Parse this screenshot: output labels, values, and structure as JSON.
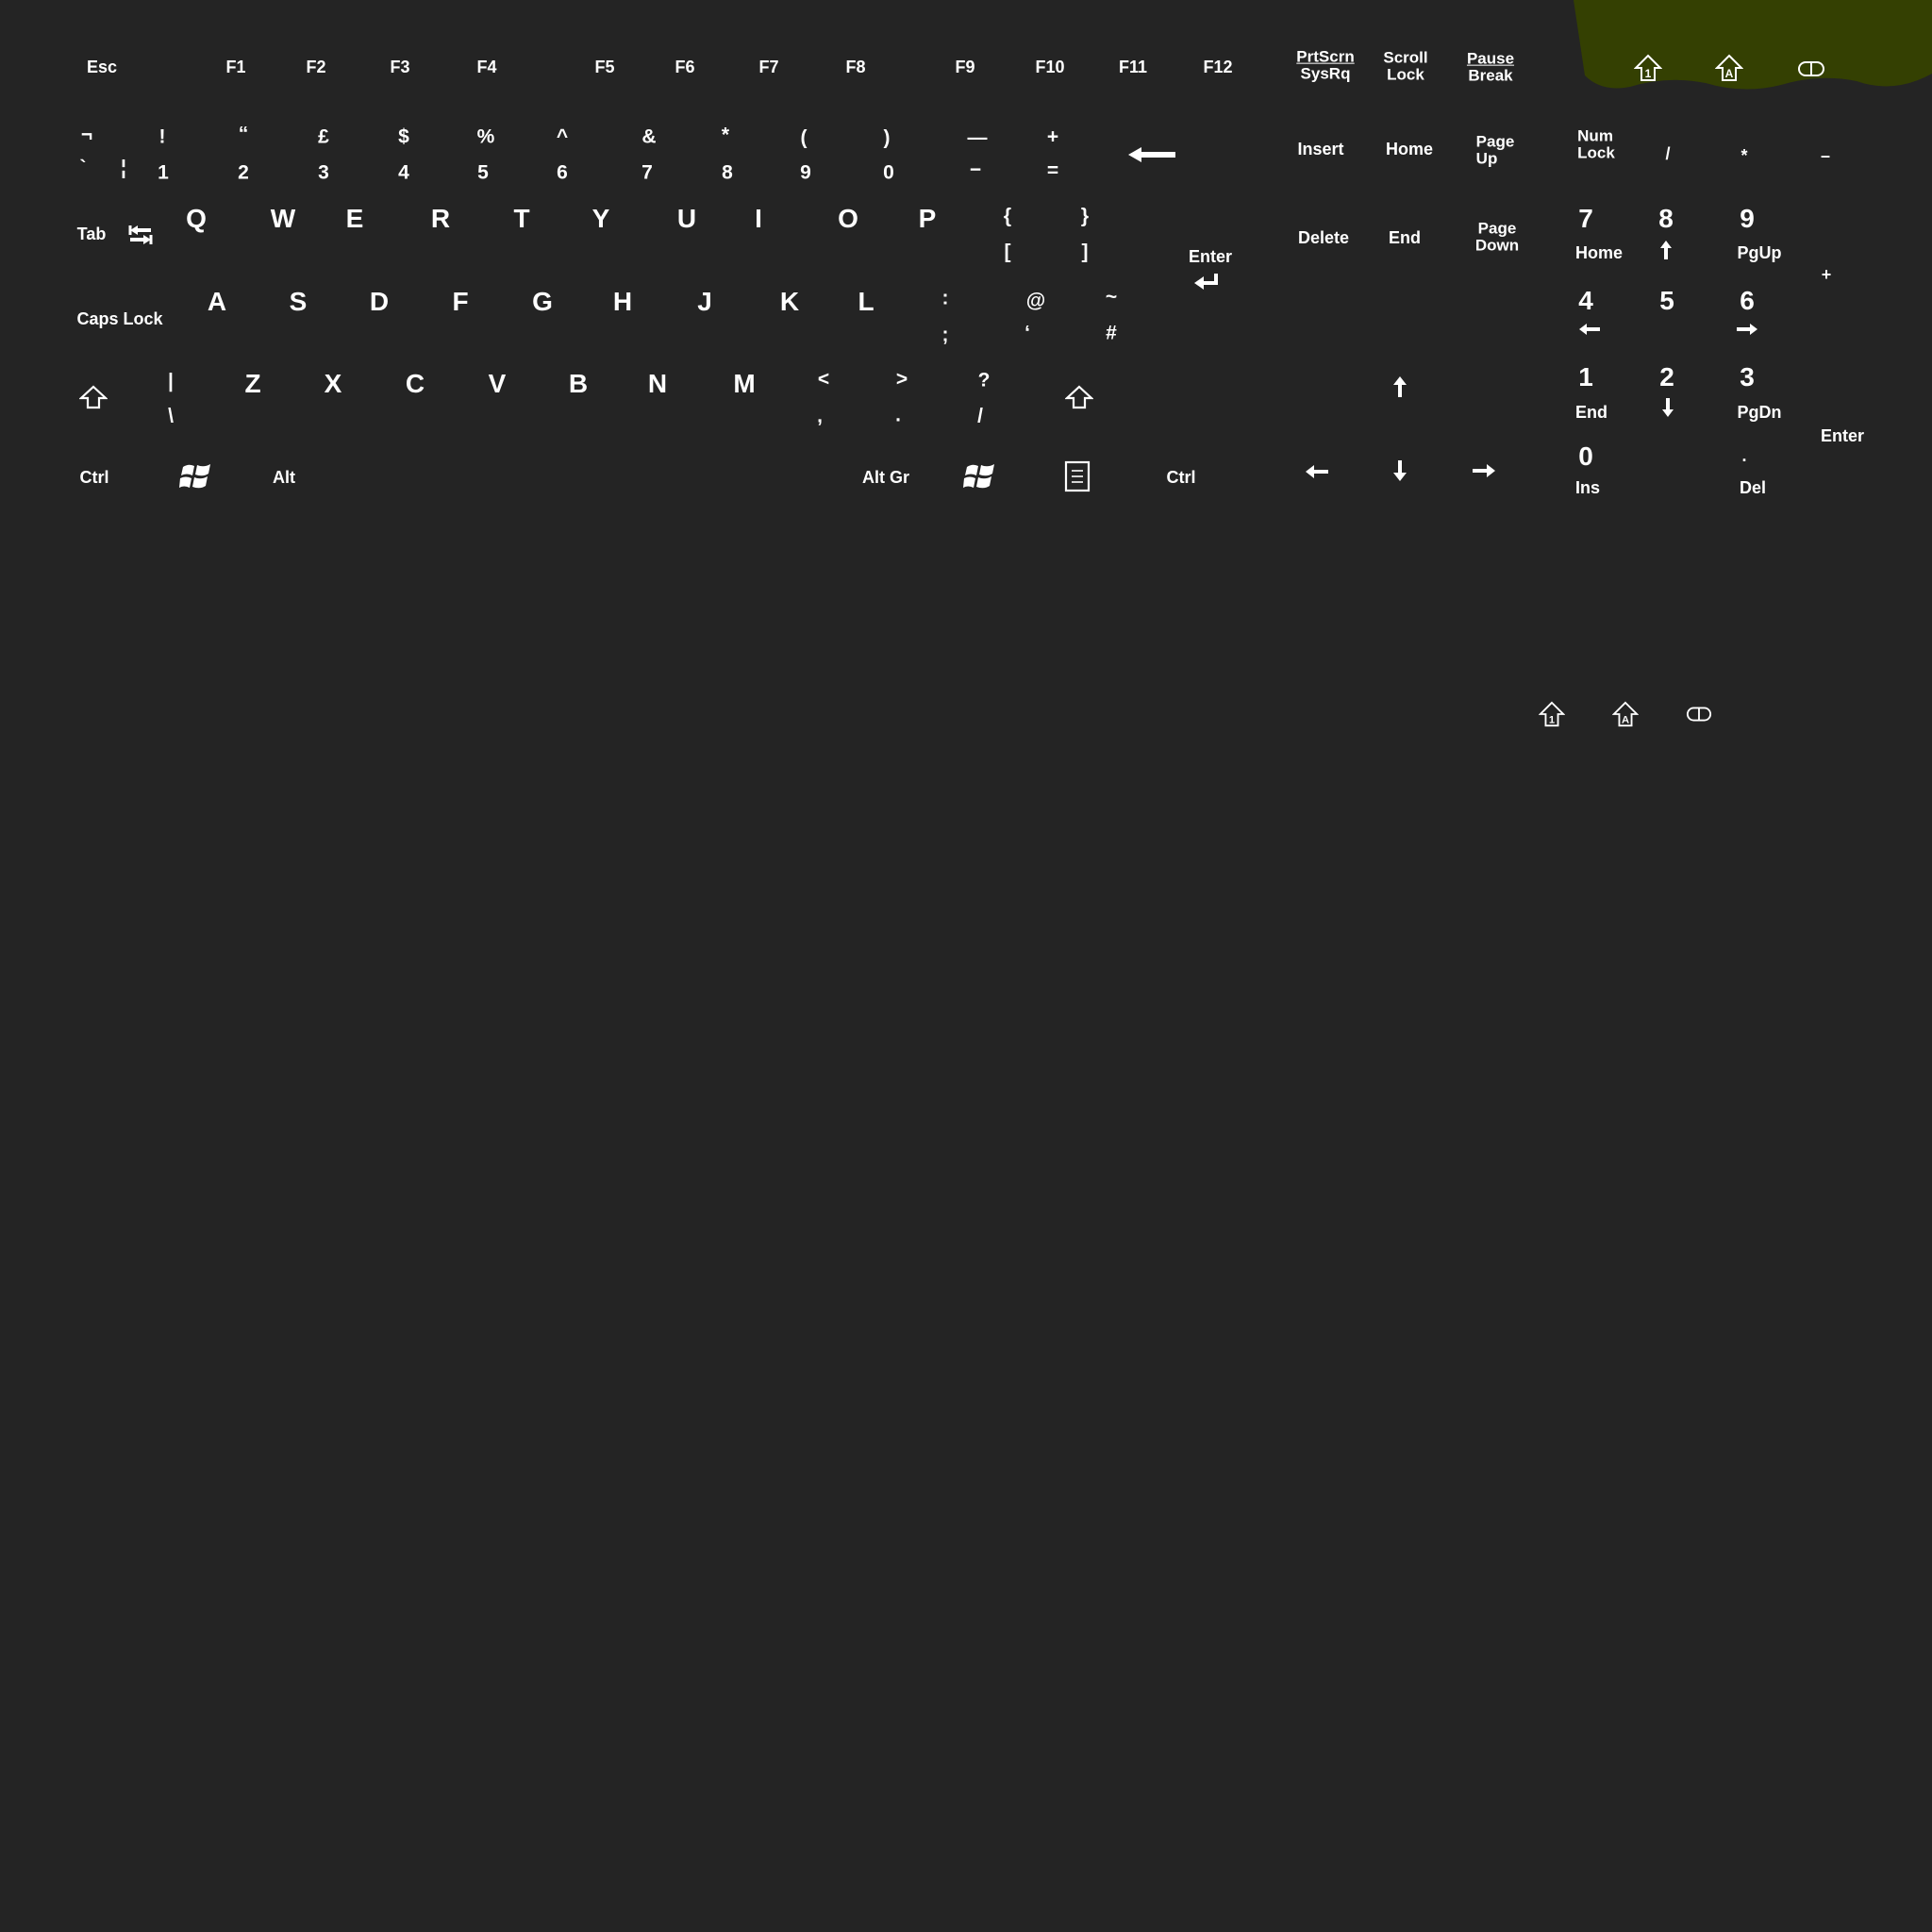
{
  "colors": {
    "background": "#242424",
    "text": "#ffffff",
    "corner_accent": "#344002"
  },
  "function_row": {
    "esc": "Esc",
    "f": [
      "F1",
      "F2",
      "F3",
      "F4",
      "F5",
      "F6",
      "F7",
      "F8",
      "F9",
      "F10",
      "F11",
      "F12"
    ],
    "prtscrn": "PrtScrn",
    "sysrq": "SysRq",
    "scroll": "Scroll",
    "scroll_lock": "Lock",
    "pause": "Pause",
    "break": "Break",
    "indicators": [
      "num-lock-indicator-icon",
      "caps-lock-indicator-icon",
      "scroll-lock-indicator-icon"
    ]
  },
  "number_row": {
    "shifted": [
      "¬",
      "!",
      "“",
      "£",
      "$",
      "%",
      "^",
      "&",
      "*",
      "(",
      ")",
      "—",
      "+"
    ],
    "base": [
      "`",
      "1",
      "2",
      "3",
      "4",
      "5",
      "6",
      "7",
      "8",
      "9",
      "0",
      "−",
      "="
    ],
    "broken_bar": "¦",
    "backspace_icon": "backspace-arrow-icon"
  },
  "qwerty_row": {
    "tab": "Tab",
    "letters": [
      "Q",
      "W",
      "E",
      "R",
      "T",
      "Y",
      "U",
      "I",
      "O",
      "P"
    ],
    "brackets_top": [
      "{",
      "}"
    ],
    "brackets_bottom": [
      "[",
      "]"
    ],
    "enter": "Enter"
  },
  "home_row": {
    "caps": "Caps Lock",
    "letters": [
      "A",
      "S",
      "D",
      "F",
      "G",
      "H",
      "J",
      "K",
      "L"
    ],
    "top": [
      ":",
      "@",
      "~"
    ],
    "bottom": [
      ";",
      "‘",
      "#"
    ]
  },
  "shift_row": {
    "pipe": "|",
    "backslash": "\\",
    "letters": [
      "Z",
      "X",
      "C",
      "V",
      "B",
      "N",
      "M"
    ],
    "top": [
      "<",
      ">",
      "?"
    ],
    "bottom": [
      ",",
      ".",
      "/"
    ]
  },
  "bottom_row": {
    "ctrl_left": "Ctrl",
    "alt": "Alt",
    "altgr": "Alt Gr",
    "ctrl_right": "Ctrl"
  },
  "nav_cluster": {
    "insert": "Insert",
    "home": "Home",
    "page_up": [
      "Page",
      "Up"
    ],
    "delete": "Delete",
    "end": "End",
    "page_down": [
      "Page",
      "Down"
    ]
  },
  "numpad": {
    "numlock": [
      "Num",
      "Lock"
    ],
    "div": "/",
    "mul": "*",
    "minus": "–",
    "plus": "+",
    "n7": "7",
    "n7_sub": "Home",
    "n8": "8",
    "n9": "9",
    "n9_sub": "PgUp",
    "n4": "4",
    "n5": "5",
    "n6": "6",
    "n1": "1",
    "n1_sub": "End",
    "n2": "2",
    "n3": "3",
    "n3_sub": "PgDn",
    "enter": "Enter",
    "n0": "0",
    "n0_sub": "Ins",
    "dot": ".",
    "dot_sub": "Del"
  }
}
